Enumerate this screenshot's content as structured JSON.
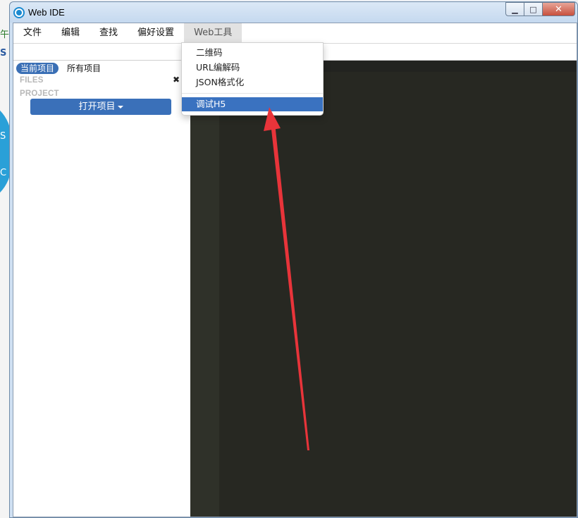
{
  "window": {
    "title": "Web IDE",
    "icon": "circle-app-icon",
    "controls": [
      "minimize",
      "maximize",
      "close"
    ]
  },
  "background_app": {
    "chars": [
      "午",
      "S",
      "S",
      "C"
    ]
  },
  "menubar": {
    "items": [
      {
        "label": "文件"
      },
      {
        "label": "编辑"
      },
      {
        "label": "查找"
      },
      {
        "label": "偏好设置"
      },
      {
        "label": "Web工具",
        "active": true
      }
    ]
  },
  "webtools_menu": {
    "items": [
      {
        "label": "二维码"
      },
      {
        "label": "URL编解码"
      },
      {
        "label": "JSON格式化"
      },
      {
        "label": "调试H5",
        "highlighted": true
      }
    ]
  },
  "sidebar": {
    "tabs": [
      {
        "label": "当前项目",
        "active": true
      },
      {
        "label": "所有项目"
      }
    ],
    "files_header": "FILES",
    "project_header": "PROJECT",
    "close_glyph": "✖",
    "open_project_label": "打开项目"
  },
  "annotation": {
    "type": "red-arrow",
    "color": "#e8343a"
  },
  "colors": {
    "accent": "#3a72c0",
    "editor_bg": "#272822",
    "gutter": "#2f3129"
  }
}
